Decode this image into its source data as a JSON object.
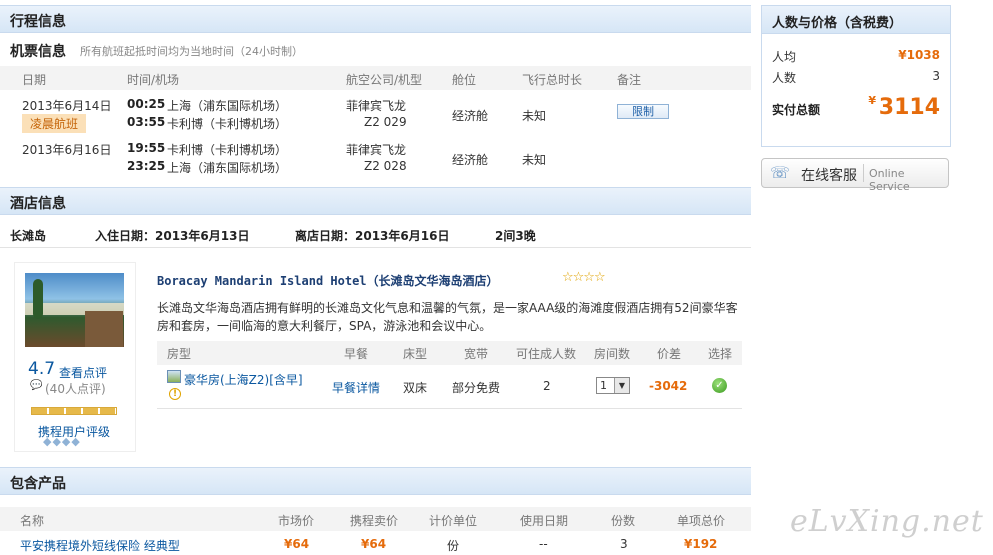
{
  "itinerary": {
    "title": "行程信息"
  },
  "flight": {
    "title": "机票信息",
    "note": "所有航班起抵时间均为当地时间（24小时制）",
    "headers": [
      "日期",
      "时间/机场",
      "航空公司/机型",
      "舱位",
      "飞行总时长",
      "备注"
    ],
    "rows": [
      {
        "date": "2013年6月14日",
        "tag": "凌晨航班",
        "dep_time": "00:25",
        "dep_airport": "上海（浦东国际机场）",
        "arr_time": "03:55",
        "arr_airport": "卡利博（卡利博机场）",
        "airline": "菲律宾飞龙",
        "flight_no": "Z2 029",
        "cabin": "经济舱",
        "duration": "未知",
        "remark": "限制"
      },
      {
        "date": "2013年6月16日",
        "dep_time": "19:55",
        "dep_airport": "卡利博（卡利博机场）",
        "arr_time": "23:25",
        "arr_airport": "上海（浦东国际机场）",
        "airline": "菲律宾飞龙",
        "flight_no": "Z2 028",
        "cabin": "经济舱",
        "duration": "未知"
      }
    ]
  },
  "hotel": {
    "title": "酒店信息",
    "city": "长滩岛",
    "checkin": "入住日期：2013年6月13日",
    "checkout": "离店日期：2013年6月16日",
    "rooms_nights": "2间3晚",
    "name": "Boracay Mandarin Island Hotel（长滩岛文华海岛酒店）",
    "stars": "☆☆☆☆",
    "description": "长滩岛文华海岛酒店拥有鲜明的长滩岛文化气息和温馨的气氛，是一家AAA级的海滩度假酒店拥有52间豪华客房和套房，一间临海的意大利餐厅，SPA，游泳池和会议中心。",
    "score": "4.7",
    "review_link": "查看点评",
    "review_count": "(40人点评)",
    "rating_label": "携程用户评级",
    "room_headers": [
      "房型",
      "早餐",
      "床型",
      "宽带",
      "可住成人数",
      "房间数",
      "价差",
      "选择"
    ],
    "room": {
      "name": "豪华房(上海Z2)[含早]",
      "breakfast": "早餐详情",
      "bed": "双床",
      "broadband": "部分免费",
      "adults": "2",
      "count": "1",
      "price_diff": "-3042"
    }
  },
  "products": {
    "title": "包含产品",
    "headers": [
      "名称",
      "市场价",
      "携程卖价",
      "计价单位",
      "使用日期",
      "份数",
      "单项总价"
    ],
    "rows": [
      {
        "name": "平安携程境外短线保险 经典型",
        "market": "¥64",
        "ctrip": "¥64",
        "unit": "份",
        "date": "--",
        "qty": "3",
        "total": "¥192"
      }
    ]
  },
  "summary": {
    "title": "人数与价格（含税费）",
    "per_person_label": "人均",
    "per_person": "¥1038",
    "count_label": "人数",
    "count": "3",
    "total_label": "实付总额",
    "total_symbol": "¥",
    "total": "3114"
  },
  "service": {
    "cn": "在线客服",
    "en": "Online Service"
  },
  "watermark": "eLvXing.net",
  "colors": {
    "accent": "#e56b0b",
    "link": "#0b58a0",
    "section_bg": "#dce9f7"
  }
}
